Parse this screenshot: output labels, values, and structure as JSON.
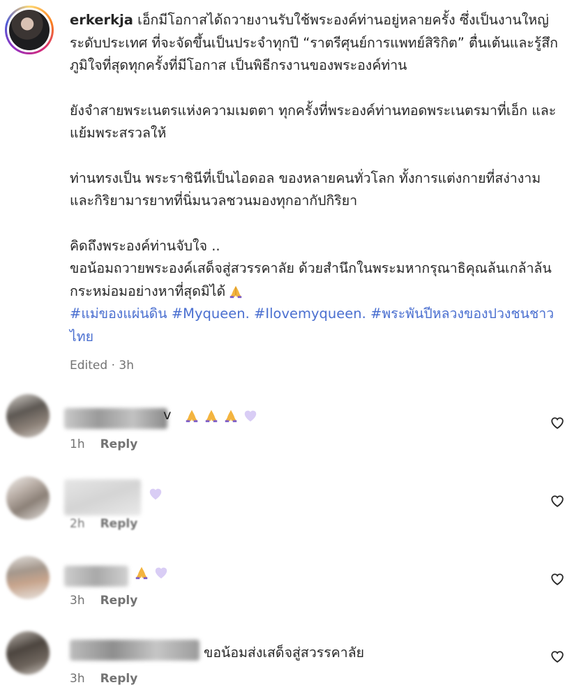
{
  "post": {
    "username": "erkerkja",
    "paragraphs": [
      "เอ็กมีโอกาสได้ถวายงานรับใช้พระองค์ท่านอยู่หลายครั้ง ซึ่งเป็นงานใหญ่ระดับประเทศ ที่จะจัดขึ้นเป็นประจำทุกปี “ราตรีศุนย์การแพทย์สิริกิต” ตื่นเต้นและรู้สึกภูมิใจที่สุดทุกครั้งที่มีโอกาส เป็นพิธีกรงานของพระองค์ท่าน",
      "ยังจำสายพระเนตรแห่งความเมตตา ทุกครั้งที่พระองค์ท่านทอดพระเนตรมาที่เอ็ก และแย้มพระสรวลให้",
      "ท่านทรงเป็น พระราชินีที่เป็นไอดอล ของหลายคนทั่วโลก ทั้งการแต่งกายที่สง่างาม และกิริยามารยาทที่นิ่มนวลชวนมองทุกอากัปกิริยา"
    ],
    "closing_line1": "คิดถึงพระองค์ท่านจับใจ ..",
    "closing_line2": "ขอน้อมถวายพระองค์เสด็จสู่สวรรคาลัย ด้วยสำนึกในพระมหากรุณาธิคุณล้นเกล้าล้นกระหม่อมอย่างหาที่สุดมิได้",
    "hashtags": "#แม่ของแผ่นดิน #Myqueen. #Ilovemyqueen. #พระพันปีหลวงของปวงชนชาวไทย",
    "edited": "Edited · 3h"
  },
  "comments": [
    {
      "name_tail": "v",
      "time": "1h",
      "reply": "Reply",
      "emojis": [
        "pray-emoji",
        "pray-emoji",
        "pray-emoji",
        "purple-heart-emoji"
      ]
    },
    {
      "name_tail": "",
      "time": "2h",
      "reply": "Reply",
      "emojis": [
        "purple-heart-emoji"
      ]
    },
    {
      "name_tail": "",
      "time": "3h",
      "reply": "Reply",
      "emojis": [
        "pray-emoji",
        "purple-heart-emoji"
      ]
    },
    {
      "name_tail": "",
      "text": "ขอน้อมส่งเสด็จสู่สวรรคาลัย",
      "time": "3h",
      "reply": "Reply",
      "emojis": []
    }
  ],
  "icons": {
    "like": "heart-outline-icon"
  },
  "colors": {
    "hashtag": "#4a6fd0",
    "meta": "#737373",
    "text": "#262626"
  }
}
